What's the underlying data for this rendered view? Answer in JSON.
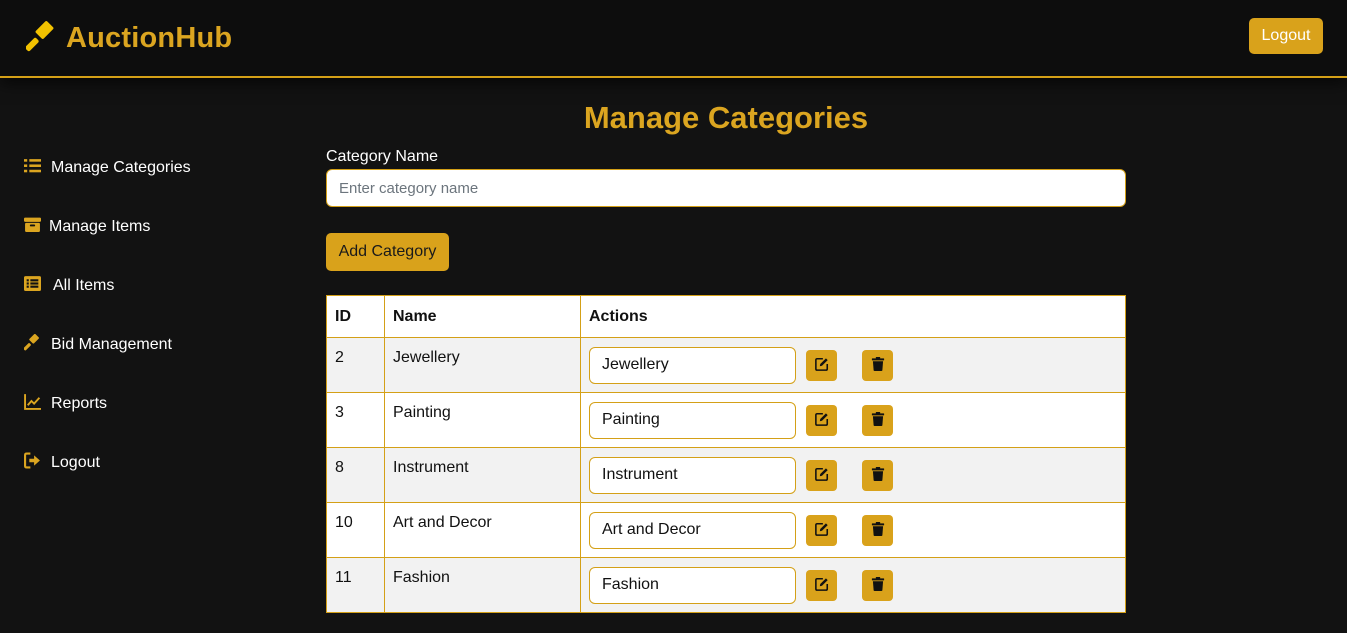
{
  "header": {
    "brand": "AuctionHub",
    "brand_icon": "gavel-icon",
    "logout_label": "Logout"
  },
  "sidebar": {
    "items": [
      {
        "label": "Manage Categories",
        "icon": "list-icon"
      },
      {
        "label": "Manage Items",
        "icon": "box-icon"
      },
      {
        "label": "All Items",
        "icon": "list-alt-icon"
      },
      {
        "label": "Bid Management",
        "icon": "gavel-icon"
      },
      {
        "label": "Reports",
        "icon": "chart-line-icon"
      },
      {
        "label": "Logout",
        "icon": "sign-out-icon"
      }
    ]
  },
  "main": {
    "title": "Manage Categories",
    "form": {
      "label": "Category Name",
      "placeholder": "Enter category name",
      "value": "",
      "submit_label": "Add Category"
    },
    "table": {
      "headers": [
        "ID",
        "Name",
        "Actions"
      ],
      "rows": [
        {
          "id": "2",
          "name": "Jewellery",
          "edit_value": "Jewellery"
        },
        {
          "id": "3",
          "name": "Painting",
          "edit_value": "Painting"
        },
        {
          "id": "8",
          "name": "Instrument",
          "edit_value": "Instrument"
        },
        {
          "id": "10",
          "name": "Art and Decor",
          "edit_value": "Art and Decor"
        },
        {
          "id": "11",
          "name": "Fashion",
          "edit_value": "Fashion"
        }
      ],
      "row_actions": {
        "edit_icon": "edit-icon",
        "delete_icon": "trash-icon"
      }
    }
  },
  "colors": {
    "accent": "#d9a21b",
    "background": "#121212",
    "header_bg": "#0d0d0d",
    "row_alt": "#f2f2f2"
  }
}
